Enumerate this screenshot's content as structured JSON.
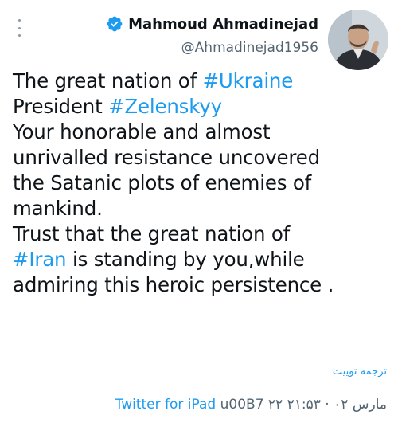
{
  "profile": {
    "display_name": "Mahmoud Ahmadinejad",
    "handle": "@Ahmadinejad1956",
    "verified": true
  },
  "tweet": {
    "line1": {
      "text": "The great nation of ",
      "hashtag": "#Ukraine"
    },
    "line2": {
      "text": "President ",
      "hashtag": "#Zelenskyy"
    },
    "line3": "Your honorable and almost",
    "line4": "unrivalled resistance uncovered",
    "line5": "the Satanic plots of enemies of",
    "line6": "mankind.",
    "line7": "Trust that the great nation of",
    "line8": {
      "hashtag": "#Iran",
      "text": " is standing by you,while"
    },
    "line9": "admiring this heroic persistence ."
  },
  "translate_label": "ترجمه توییت",
  "footer": {
    "source": "Twitter for iPad",
    "separator": " u00B7 ",
    "datetime": "۲۲ مارس ۰۲ · ۲۱:۵۳"
  },
  "colors": {
    "link": "#1d9bf0",
    "text": "#0f1419",
    "secondary": "#536471",
    "verified": "#1d9bf0"
  },
  "icons": {
    "more": "more-vertical-icon",
    "verified": "verified-badge-icon"
  }
}
